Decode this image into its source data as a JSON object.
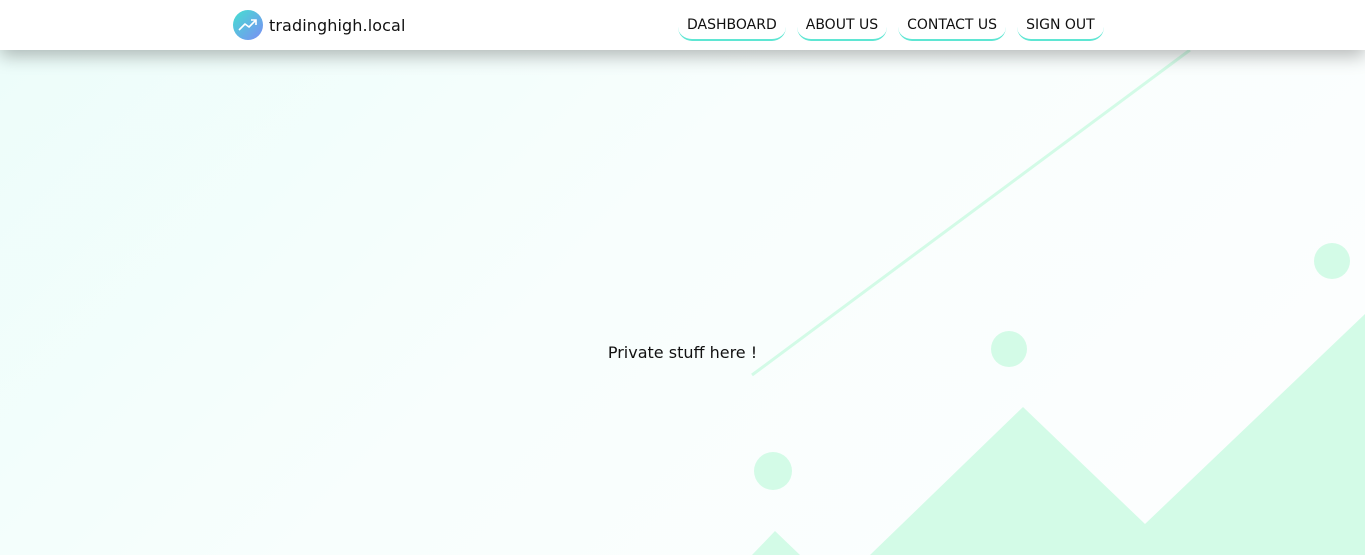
{
  "brand": {
    "name": "tradinghigh.local",
    "logo_icon": "trending-up-icon"
  },
  "nav": {
    "items": [
      {
        "label": "DASHBOARD"
      },
      {
        "label": "ABOUT US"
      },
      {
        "label": "CONTACT US"
      },
      {
        "label": "SIGN OUT"
      }
    ]
  },
  "main": {
    "message": "Private stuff here !"
  },
  "colors": {
    "accent_mint": "#d3fbe7",
    "accent_teal": "#5fe6d3",
    "logo_gradient_start": "#44e0d0",
    "logo_gradient_end": "#7b8cf5"
  }
}
